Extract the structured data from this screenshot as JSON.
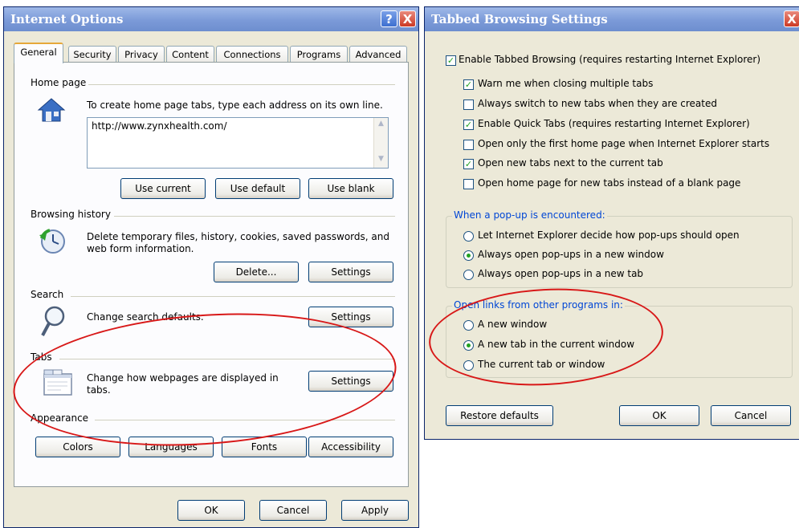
{
  "internet_options": {
    "title": "Internet Options",
    "tabs": [
      "General",
      "Security",
      "Privacy",
      "Content",
      "Connections",
      "Programs",
      "Advanced"
    ],
    "home_page": {
      "heading": "Home page",
      "description": "To create home page tabs, type each address on its own line.",
      "url": "http://www.zynxhealth.com/",
      "buttons": [
        "Use current",
        "Use default",
        "Use blank"
      ]
    },
    "browsing_history": {
      "heading": "Browsing history",
      "description": "Delete temporary files, history, cookies, saved passwords, and web form information.",
      "delete_label": "Delete...",
      "settings_label": "Settings"
    },
    "search": {
      "heading": "Search",
      "description": "Change search defaults.",
      "settings_label": "Settings"
    },
    "tabs_section": {
      "heading": "Tabs",
      "description": "Change how webpages are displayed in tabs.",
      "settings_label": "Settings"
    },
    "appearance": {
      "heading": "Appearance",
      "buttons": [
        "Colors",
        "Languages",
        "Fonts",
        "Accessibility"
      ]
    },
    "footer": {
      "ok": "OK",
      "cancel": "Cancel",
      "apply": "Apply"
    },
    "help_glyph": "?",
    "close_glyph": "X"
  },
  "tabbed_settings": {
    "title": "Tabbed Browsing Settings",
    "close_glyph": "X",
    "enable": {
      "label": "Enable Tabbed Browsing (requires restarting Internet Explorer)",
      "checked": true
    },
    "options": [
      {
        "label": "Warn me when closing multiple tabs",
        "checked": true
      },
      {
        "label": "Always switch to new tabs when they are created",
        "checked": false
      },
      {
        "label": "Enable Quick Tabs (requires restarting Internet Explorer)",
        "checked": true
      },
      {
        "label": "Open only the first home page when Internet Explorer starts",
        "checked": false
      },
      {
        "label": "Open new tabs next to the current tab",
        "checked": true
      },
      {
        "label": "Open home page for new tabs instead of a blank page",
        "checked": false
      }
    ],
    "popup_group": {
      "title": "When a pop-up is encountered:",
      "options": [
        {
          "label": "Let Internet Explorer decide how pop-ups should open",
          "selected": false
        },
        {
          "label": "Always open pop-ups in a new window",
          "selected": true
        },
        {
          "label": "Always open pop-ups in a new tab",
          "selected": false
        }
      ]
    },
    "links_group": {
      "title": "Open links from other programs in:",
      "options": [
        {
          "label": "A new window",
          "selected": false
        },
        {
          "label": "A new tab in the current window",
          "selected": true
        },
        {
          "label": "The current tab or window",
          "selected": false
        }
      ]
    },
    "restore_label": "Restore defaults",
    "ok": "OK",
    "cancel": "Cancel"
  },
  "colors": {
    "highlight_ring": "#d81818",
    "check_green": "#21a121",
    "group_title": "#0046d5"
  }
}
